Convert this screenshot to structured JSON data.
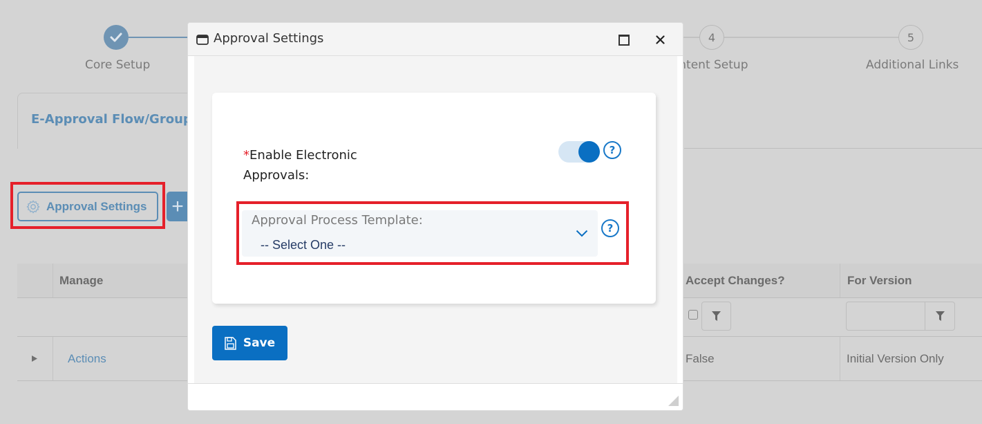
{
  "stepper": {
    "steps": [
      {
        "number": "",
        "label": "Core Setup",
        "status": "completed"
      },
      {
        "number": "4",
        "label": "Content Setup",
        "status": "pending"
      },
      {
        "number": "5",
        "label": "Additional Links",
        "status": "pending"
      }
    ]
  },
  "tab": {
    "title": "E-Approval Flow/Groups"
  },
  "toolbar": {
    "approval_settings_label": "Approval Settings",
    "add_label": "+"
  },
  "grid": {
    "columns": [
      "Manage",
      "Accept Changes?",
      "For Version"
    ],
    "filters": {
      "for_version_value": ""
    },
    "rows": [
      {
        "manage": "Actions",
        "accept_changes": "False",
        "for_version": "Initial Version Only"
      }
    ]
  },
  "modal": {
    "title": "Approval Settings",
    "enable_label_required": "*",
    "enable_label": "Enable Electronic Approvals:",
    "enable_value": true,
    "template_label": "Approval Process Template:",
    "template_value": "-- Select One --",
    "help_glyph": "?",
    "save_label": "Save"
  },
  "colors": {
    "primary": "#0a6fc2",
    "highlight": "#e5202a",
    "muted_blue": "#5b8db5"
  }
}
